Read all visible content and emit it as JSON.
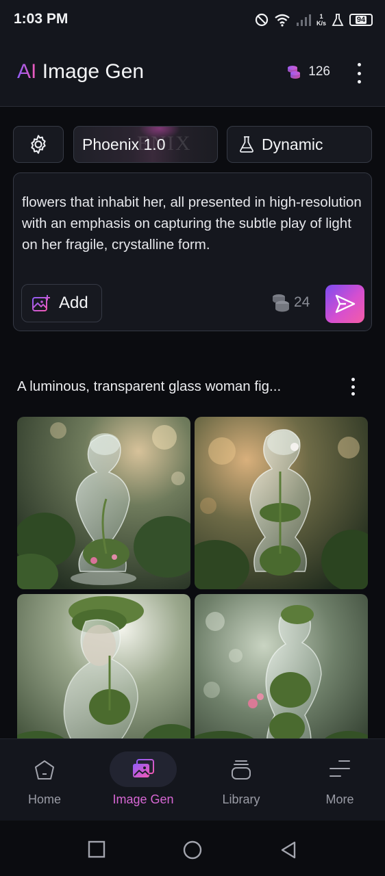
{
  "status_bar": {
    "time": "1:03 PM",
    "net_speed_value": "1",
    "net_speed_unit": "K/s",
    "battery": "94",
    "icons": [
      "do-not-disturb-icon",
      "wifi-icon",
      "signal-icon",
      "lab-icon",
      "battery-icon"
    ]
  },
  "header": {
    "title_prefix": "AI",
    "title_rest": " Image Gen",
    "credits": "126",
    "credits_icon": "coins-icon",
    "menu_icon": "more-vertical-icon"
  },
  "toolbar": {
    "settings_icon": "gear-icon",
    "model_label": "Phoenix 1.0",
    "model_watermark": "ENIX",
    "style_icon": "flask-icon",
    "style_label": "Dynamic"
  },
  "prompt": {
    "text": "flowers that inhabit her, all presented in high-resolution with an emphasis on capturing the subtle play of light on her fragile, crystalline form.",
    "add_label": "Add",
    "add_icon": "image-add-icon",
    "cost": "24",
    "cost_icon": "coins-icon",
    "send_icon": "send-icon"
  },
  "gallery": {
    "prompt_title": "A luminous, transparent glass woman fig...",
    "menu_icon": "more-vertical-icon",
    "image_count": 4
  },
  "bottom_nav": {
    "items": [
      {
        "label": "Home",
        "icon": "home-icon"
      },
      {
        "label": "Image Gen",
        "icon": "images-icon",
        "active": true
      },
      {
        "label": "Library",
        "icon": "library-icon"
      },
      {
        "label": "More",
        "icon": "menu-icon"
      }
    ]
  },
  "system_nav": {
    "buttons": [
      "recents-button",
      "home-button",
      "back-button"
    ]
  },
  "colors": {
    "background": "#0b0c10",
    "surface": "#14161d",
    "accent_start": "#8f5cf7",
    "accent_end": "#f35ab6",
    "active_nav": "#d767d4"
  }
}
